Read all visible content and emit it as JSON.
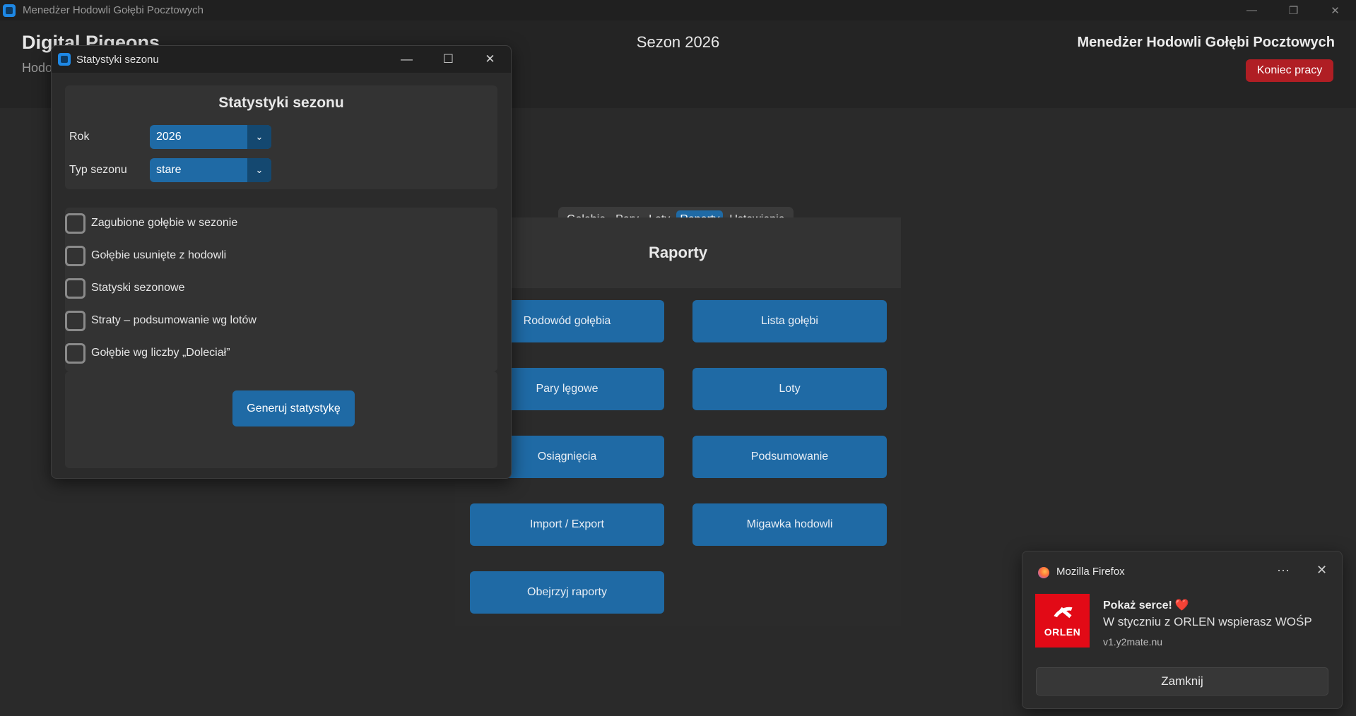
{
  "window": {
    "title": "Menedżer Hodowli Gołębi Pocztowych",
    "controls": [
      "—",
      "❐",
      "✕"
    ]
  },
  "header": {
    "brand_title": "Digital Pigeons",
    "brand_sub": "Hodo",
    "season": "Sezon 2026",
    "app_name": "Menedżer Hodowli Gołębi Pocztowych",
    "logout_label": "Koniec pracy",
    "logout_color": "#b01e24"
  },
  "tabs": [
    {
      "label": "Gołębie",
      "active": false
    },
    {
      "label": "Pary",
      "active": false
    },
    {
      "label": "Loty",
      "active": false
    },
    {
      "label": "Raporty",
      "active": true
    },
    {
      "label": "Ustawienia",
      "active": false
    }
  ],
  "reports": {
    "title": "Raporty",
    "buttons": [
      "Rodowód gołębia",
      "Lista gołębi",
      "Pary lęgowe",
      "Loty",
      "Osiągnięcia",
      "Podsumowanie",
      "Import / Export",
      "Migawka hodowli",
      "Obejrzyj raporty"
    ]
  },
  "dialog": {
    "window_title": "Statystyki sezonu",
    "heading": "Statystyki sezonu",
    "year_label": "Rok",
    "year_value": "2026",
    "season_type_label": "Typ sezonu",
    "season_type_value": "stare",
    "checkboxes": [
      {
        "label": "Zagubione gołębie w sezonie",
        "checked": false
      },
      {
        "label": "Gołębie usunięte z hodowli",
        "checked": false
      },
      {
        "label": "Statyski sezonowe",
        "checked": false
      },
      {
        "label": "Straty – podsumowanie wg lotów",
        "checked": false
      },
      {
        "label": "Gołębie wg liczby „Doleciał”",
        "checked": false
      }
    ],
    "generate_label": "Generuj statystykę"
  },
  "toast": {
    "app": "Mozilla Firefox",
    "more": "···",
    "close": "✕",
    "logo_text": "ORLEN",
    "title": "Pokaż serce!",
    "heart": "❤️",
    "body": "W styczniu z ORLEN wspierasz WOŚP",
    "source": "v1.y2mate.nu",
    "button": "Zamknij"
  },
  "colors": {
    "accent": "#1f6aa5",
    "accent_dark": "#144870",
    "background": "#242424",
    "panel": "#333333",
    "danger": "#b01e24",
    "orlen_red": "#e20a16"
  }
}
